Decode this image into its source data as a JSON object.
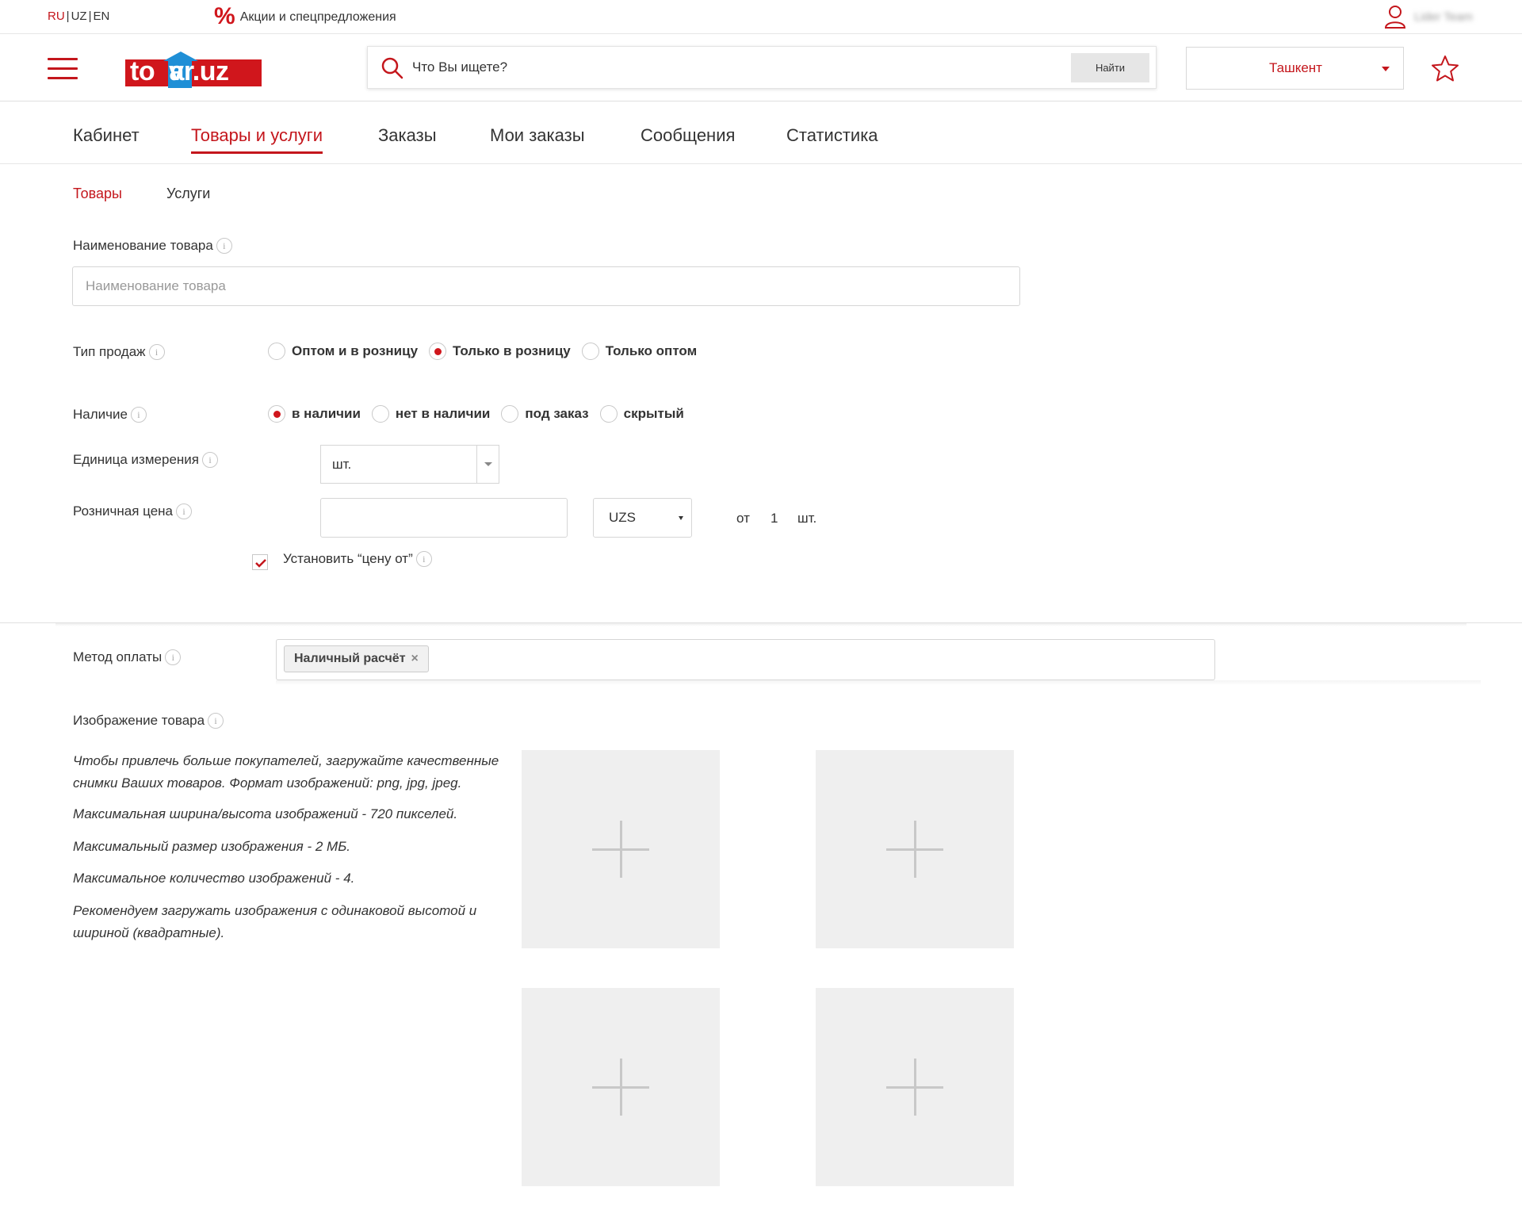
{
  "lang": {
    "items": [
      "RU",
      "UZ",
      "EN"
    ],
    "active": "RU",
    "separator": "|"
  },
  "promo": {
    "icon": "percent-icon",
    "text": "Акции и спецпредложения"
  },
  "user": {
    "icon": "user-icon",
    "name": "Lider Team"
  },
  "header": {
    "logo": {
      "part1": "to",
      "part2": "v",
      "part3": "ar.uz"
    },
    "search": {
      "placeholder": "Что Вы ищете?",
      "button": "Найти"
    },
    "city": "Ташкент"
  },
  "nav": {
    "items": [
      "Кабинет",
      "Товары и услуги",
      "Заказы",
      "Мои заказы",
      "Сообщения",
      "Статистика"
    ],
    "active": "Товары и услуги"
  },
  "subtabs": [
    "Товары",
    "Услуги"
  ],
  "form": {
    "name_label": "Наименование товара",
    "name_placeholder": "Наименование товара",
    "sale_type_label": "Тип продаж",
    "sale_type_options": [
      "Оптом и в розницу",
      "Только в розницу",
      "Только оптом"
    ],
    "sale_type_selected": "Только в розницу",
    "availability_label": "Наличие",
    "availability_options": [
      "в наличии",
      "нет в наличии",
      "под заказ",
      "скрытый"
    ],
    "availability_selected": "в наличии",
    "unit_label": "Единица измерения",
    "unit_value": "шт.",
    "price_label": "Розничная цена",
    "price_value": "",
    "currency": "UZS",
    "from_label": "от",
    "from_value": "1",
    "from_unit": "шт.",
    "price_from_checkbox": "Установить “цену от”",
    "price_from_checked": true,
    "payment_label": "Метод оплаты",
    "payment_tags": [
      "Наличный расчёт"
    ],
    "images_label": "Изображение товара",
    "image_hints": [
      "Чтобы привлечь больше покупателей, загружайте качественные снимки Ваших товаров. Формат изображений: png, jpg, jpeg.",
      "Максимальная ширина/высота изображений - 720 пикселей.",
      "Максимальный размер изображения - 2 МБ.",
      "Максимальное количество изображений - 4.",
      "Рекомендуем загружать изображения с одинаковой высотой и шириной (квадратные)."
    ],
    "info_glyph": "i",
    "tag_remove_glyph": "×"
  },
  "colors": {
    "accent": "#c4161c",
    "logo_red": "#d0161c",
    "logo_blue": "#1f8fd6",
    "upload_bg": "#efefef"
  }
}
